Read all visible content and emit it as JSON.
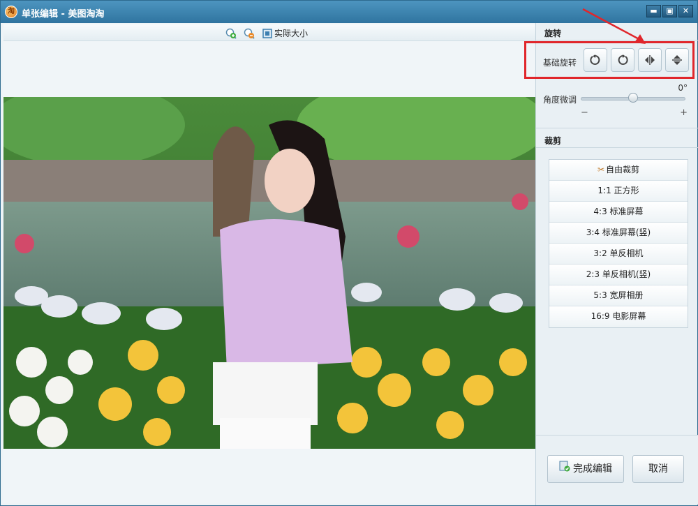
{
  "window": {
    "title": "单张编辑 - 美图淘淘",
    "logo_glyph": "淘"
  },
  "window_controls": {
    "minimize": "▬",
    "maximize": "▣",
    "close": "✕"
  },
  "toolbar": {
    "zoom_in_icon": "zoom-in-icon",
    "zoom_out_icon": "zoom-out-icon",
    "actual_size_label": "实际大小"
  },
  "photo": {
    "description_icon": "photo-image"
  },
  "rotate": {
    "section_title": "旋转",
    "basic_label": "基础旋转",
    "buttons": [
      "rotate-left",
      "rotate-right",
      "flip-horizontal",
      "flip-vertical"
    ],
    "fine_label": "角度微调",
    "angle_value": "0°",
    "slider_level": 0.5,
    "minus": "−",
    "plus": "+"
  },
  "crop": {
    "section_title": "裁剪",
    "items": [
      "自由裁剪",
      "1:1 正方形",
      "4:3 标准屏幕",
      "3:4 标准屏幕(竖)",
      "3:2 单反相机",
      "2:3 单反相机(竖)",
      "5:3 宽屏相册",
      "16:9 电影屏幕"
    ]
  },
  "actions": {
    "done_label": "完成编辑",
    "cancel_label": "取消"
  },
  "colors": {
    "accent": "#2f74a0",
    "highlight": "#e0262b"
  }
}
